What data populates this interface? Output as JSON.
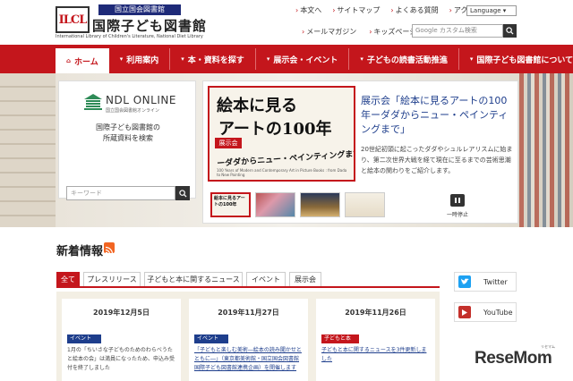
{
  "header": {
    "logo_text": "ILCL",
    "org_small": "国立国会図書館",
    "org_name": "国際子ども図書館",
    "org_en": "International Library of Children's Literature, National Diet Library",
    "util_links": [
      "本文へ",
      "サイトマップ",
      "よくある質問",
      "アクセス"
    ],
    "language": "Language",
    "util_links2": [
      "メールマガジン",
      "キッズページ"
    ],
    "search_placeholder": "Google カスタム検索"
  },
  "nav": {
    "items": [
      {
        "label": "ホーム",
        "active": true
      },
      {
        "label": "利用案内"
      },
      {
        "label": "本・資料を探す"
      },
      {
        "label": "展示会・イベント"
      },
      {
        "label": "子どもの読書活動推進"
      },
      {
        "label": "国際子ども図書館について"
      }
    ]
  },
  "ndl": {
    "title": "NDL ONLINE",
    "subtitle": "国立国会図書館オンライン",
    "desc_line1": "国際子ども図書館の",
    "desc_line2": "所蔵資料を検索",
    "input_placeholder": "キーワード"
  },
  "feature": {
    "poster_line1": "絵本に見る",
    "poster_line2": "アートの100年",
    "poster_badge": "展示会",
    "poster_line3": "ーダダからニュー・ペインティングまで",
    "poster_en": "100 Years of Modern and Contemporary Art in Picture Books : from Dada to New Painting",
    "title": "展示会「絵本に見るアートの100年ーダダからニュー・ペインティングまで」",
    "body": "20世紀初頭に起こったダダやシュルレアリスムに始まり、第二次世界大戦を経て現在に至るまでの芸術思潮と絵本の関わりをご紹介します。",
    "thumbs": [
      "絵本に見るアートの100年",
      "",
      "",
      ""
    ],
    "pause_label": "一時停止"
  },
  "news": {
    "heading": "新着情報",
    "tabs": [
      "全て",
      "プレスリリース",
      "子どもと本に関するニュース",
      "イベント",
      "展示会"
    ],
    "cards": [
      {
        "date": "2019年12月5日",
        "category": "イベント",
        "text": "1月の「ちいさな子どものためのわらべうたと絵本の会」は満員になったため、申込み受付を終了しました",
        "link": false
      },
      {
        "date": "2019年11月27日",
        "category": "イベント",
        "text": "「子どもと楽しむ美術―絵本の読み聞かせとともに―」（東京都美術館・国立国会図書館国際子ども図書館連携企画）を開催します",
        "link": true
      },
      {
        "date": "2019年11月26日",
        "category": "子どもと本",
        "text": "子どもと本に関するニュースを3件更新しました",
        "link": true
      }
    ]
  },
  "social": {
    "twitter": "Twitter",
    "youtube": "YouTube"
  },
  "watermark": {
    "text": "ReseMom",
    "sub": "リセマム"
  },
  "colors": {
    "brand_red": "#c4161c",
    "brand_navy": "#1e3e8c",
    "twitter_blue": "#1da1f2",
    "youtube_red": "#c4302b"
  }
}
